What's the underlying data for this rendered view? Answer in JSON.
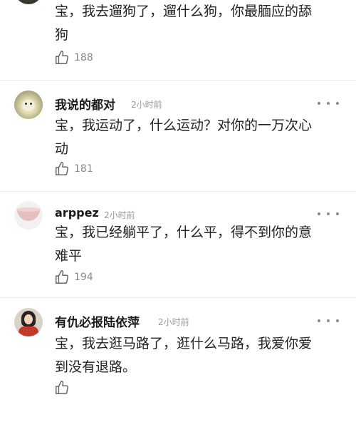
{
  "comments": [
    {
      "username": "",
      "time": "",
      "text_line1": "宝，我去遛狗了，遛什么狗，你最腼应的舔",
      "text_line2": "狗",
      "likes": "188"
    },
    {
      "username": "我说的都对",
      "time": "2小时前",
      "text_line1": "宝，我运动了，什么运动？对你的一万次心",
      "text_line2": "动",
      "likes": "181"
    },
    {
      "username": "arppez",
      "time": "2小时前",
      "text_line1": "宝，我已经躺平了，什么平，得不到你的意",
      "text_line2": "难平",
      "likes": "194"
    },
    {
      "username": "有仇必报陆依萍",
      "time": "2小时前",
      "text_line1": "宝，我去逛马路了，逛什么马路，我爱你爱",
      "text_line2": "到没有退路。",
      "likes": ""
    }
  ],
  "icons": {
    "like": "thumbs-up-icon",
    "more": "more-dots-icon"
  },
  "colors": {
    "text": "#222222",
    "meta": "#9a9a9a",
    "divider": "#ececec"
  }
}
